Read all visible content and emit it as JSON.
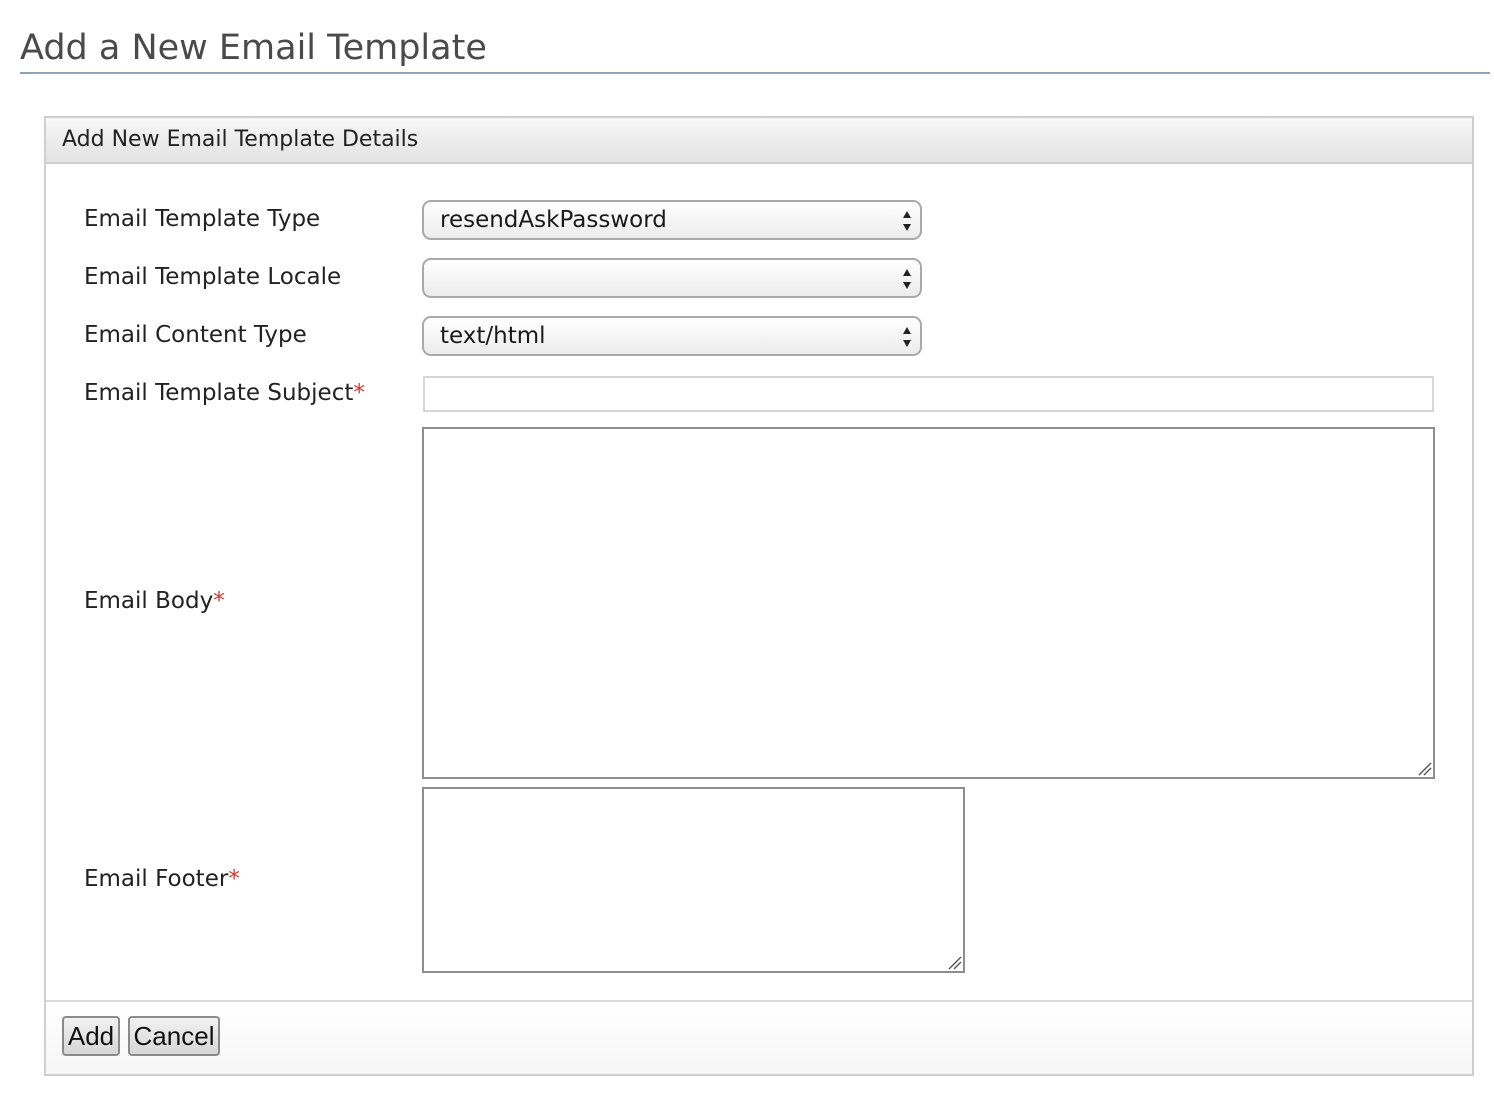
{
  "page": {
    "title": "Add a New Email Template"
  },
  "panel": {
    "header": "Add New Email Template Details"
  },
  "form": {
    "template_type": {
      "label": "Email Template Type",
      "value": "resendAskPassword"
    },
    "template_locale": {
      "label": "Email Template Locale",
      "value": ""
    },
    "content_type": {
      "label": "Email Content Type",
      "value": "text/html"
    },
    "subject": {
      "label": "Email Template Subject",
      "required_mark": "*",
      "value": ""
    },
    "body": {
      "label": "Email Body",
      "required_mark": "*",
      "value": ""
    },
    "footer": {
      "label": "Email Footer",
      "required_mark": "*",
      "value": ""
    }
  },
  "actions": {
    "add_label": "Add",
    "cancel_label": "Cancel"
  },
  "icons": {
    "select_arrows": "up-down-arrows-icon",
    "resize_grip": "resize-grip-icon"
  },
  "colors": {
    "title_rule": "#8ea2b4",
    "required": "#d9342b",
    "panel_border": "#cfcfcf"
  }
}
